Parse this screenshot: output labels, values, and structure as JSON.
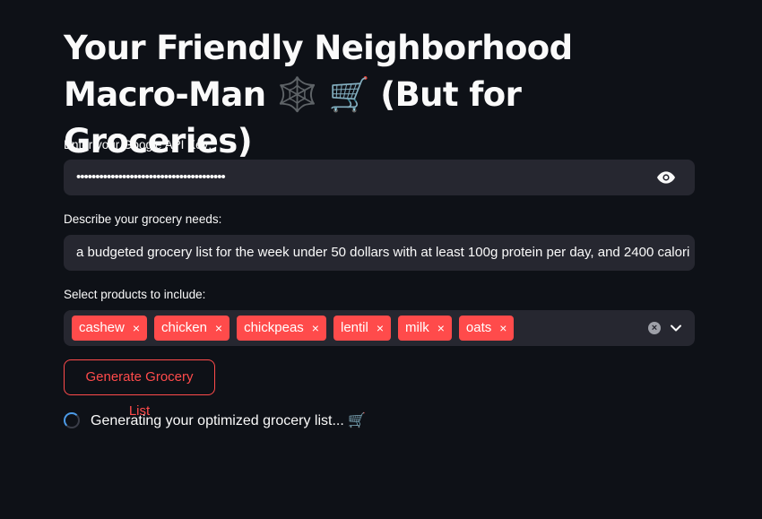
{
  "title": "Your Friendly Neighborhood Macro-Man 🕸️ 🛒 (But for Groceries)",
  "api_key": {
    "label": "Enter your Google API Key:",
    "masked_value": "•••••••••••••••••••••••••••••••••••••••"
  },
  "needs": {
    "label": "Describe your grocery needs:",
    "value": "a budgeted grocery list for the week under 50 dollars with at least 100g protein per day, and 2400 calori"
  },
  "products": {
    "label": "Select products to include:",
    "selected": [
      "cashew",
      "chicken",
      "chickpeas",
      "lentil",
      "milk",
      "oats"
    ],
    "remove_symbol": "×"
  },
  "generate_button": "Generate Grocery List",
  "status": "Generating your optimized grocery list... 🛒",
  "colors": {
    "background": "#0e1117",
    "input_bg": "#262730",
    "accent": "#ff4b4b",
    "spinner": "#4c9be8"
  }
}
